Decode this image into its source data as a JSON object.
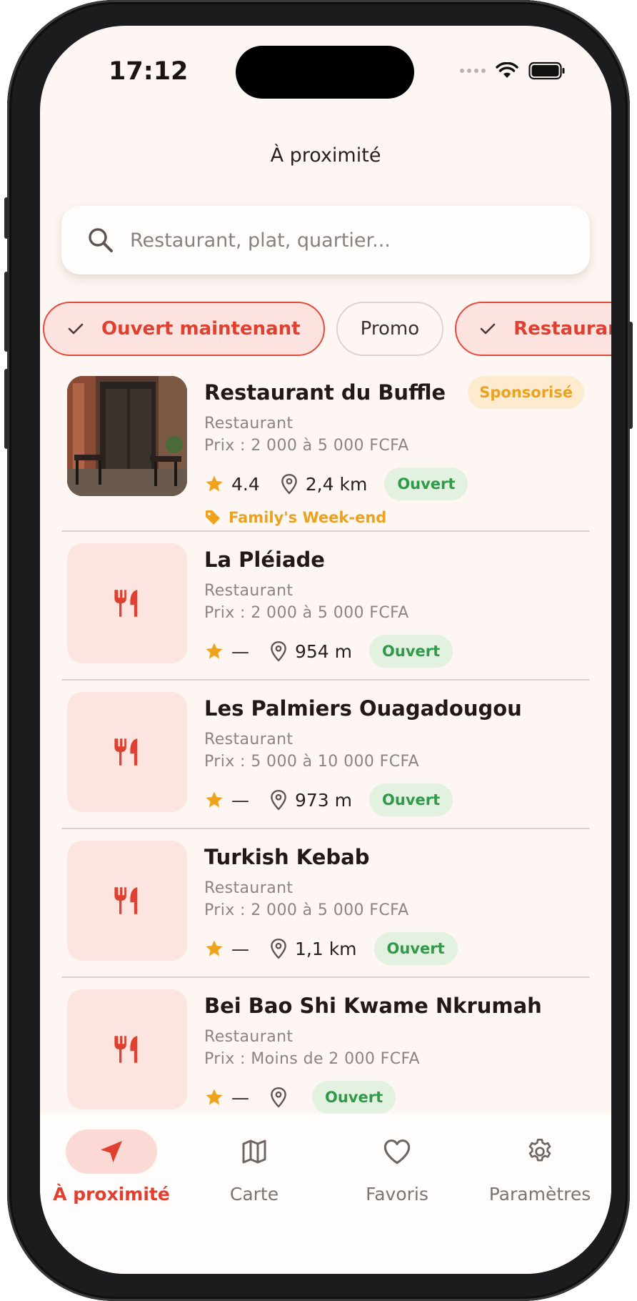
{
  "status_bar": {
    "time": "17:12"
  },
  "header": {
    "title": "À proximité"
  },
  "search": {
    "placeholder": "Restaurant, plat, quartier..."
  },
  "filters": [
    {
      "label": "Ouvert maintenant",
      "selected": true
    },
    {
      "label": "Promo",
      "selected": false
    },
    {
      "label": "Restaurant",
      "selected": true
    }
  ],
  "restaurants": [
    {
      "name": "Restaurant du Buffle",
      "category": "Restaurant",
      "price": "Prix : 2 000 à 5 000 FCFA",
      "rating": "4.4",
      "distance": "2,4 km",
      "status": "Ouvert",
      "sponsored": "Sponsorisé",
      "promo": "Family's Week-end"
    },
    {
      "name": "La Pléiade",
      "category": "Restaurant",
      "price": "Prix : 2 000 à 5 000 FCFA",
      "rating": "—",
      "distance": "954 m",
      "status": "Ouvert"
    },
    {
      "name": "Les Palmiers Ouagadougou",
      "category": "Restaurant",
      "price": "Prix : 5 000 à 10 000 FCFA",
      "rating": "—",
      "distance": "973 m",
      "status": "Ouvert"
    },
    {
      "name": "Turkish Kebab",
      "category": "Restaurant",
      "price": "Prix : 2 000 à 5 000 FCFA",
      "rating": "—",
      "distance": "1,1 km",
      "status": "Ouvert"
    },
    {
      "name": "Bei Bao Shi Kwame Nkrumah",
      "category": "Restaurant",
      "price": "Prix : Moins de 2 000 FCFA",
      "rating": "—",
      "distance": "",
      "status": "Ouvert"
    }
  ],
  "tabs": [
    {
      "label": "À proximité",
      "icon": "navigation-arrow-icon",
      "active": true
    },
    {
      "label": "Carte",
      "icon": "map-icon",
      "active": false
    },
    {
      "label": "Favoris",
      "icon": "heart-icon",
      "active": false
    },
    {
      "label": "Paramètres",
      "icon": "gear-icon",
      "active": false
    }
  ],
  "colors": {
    "accent": "#e0402f",
    "open_green": "#2f9a47",
    "star": "#f0a31a",
    "background": "#fdf6f2"
  }
}
